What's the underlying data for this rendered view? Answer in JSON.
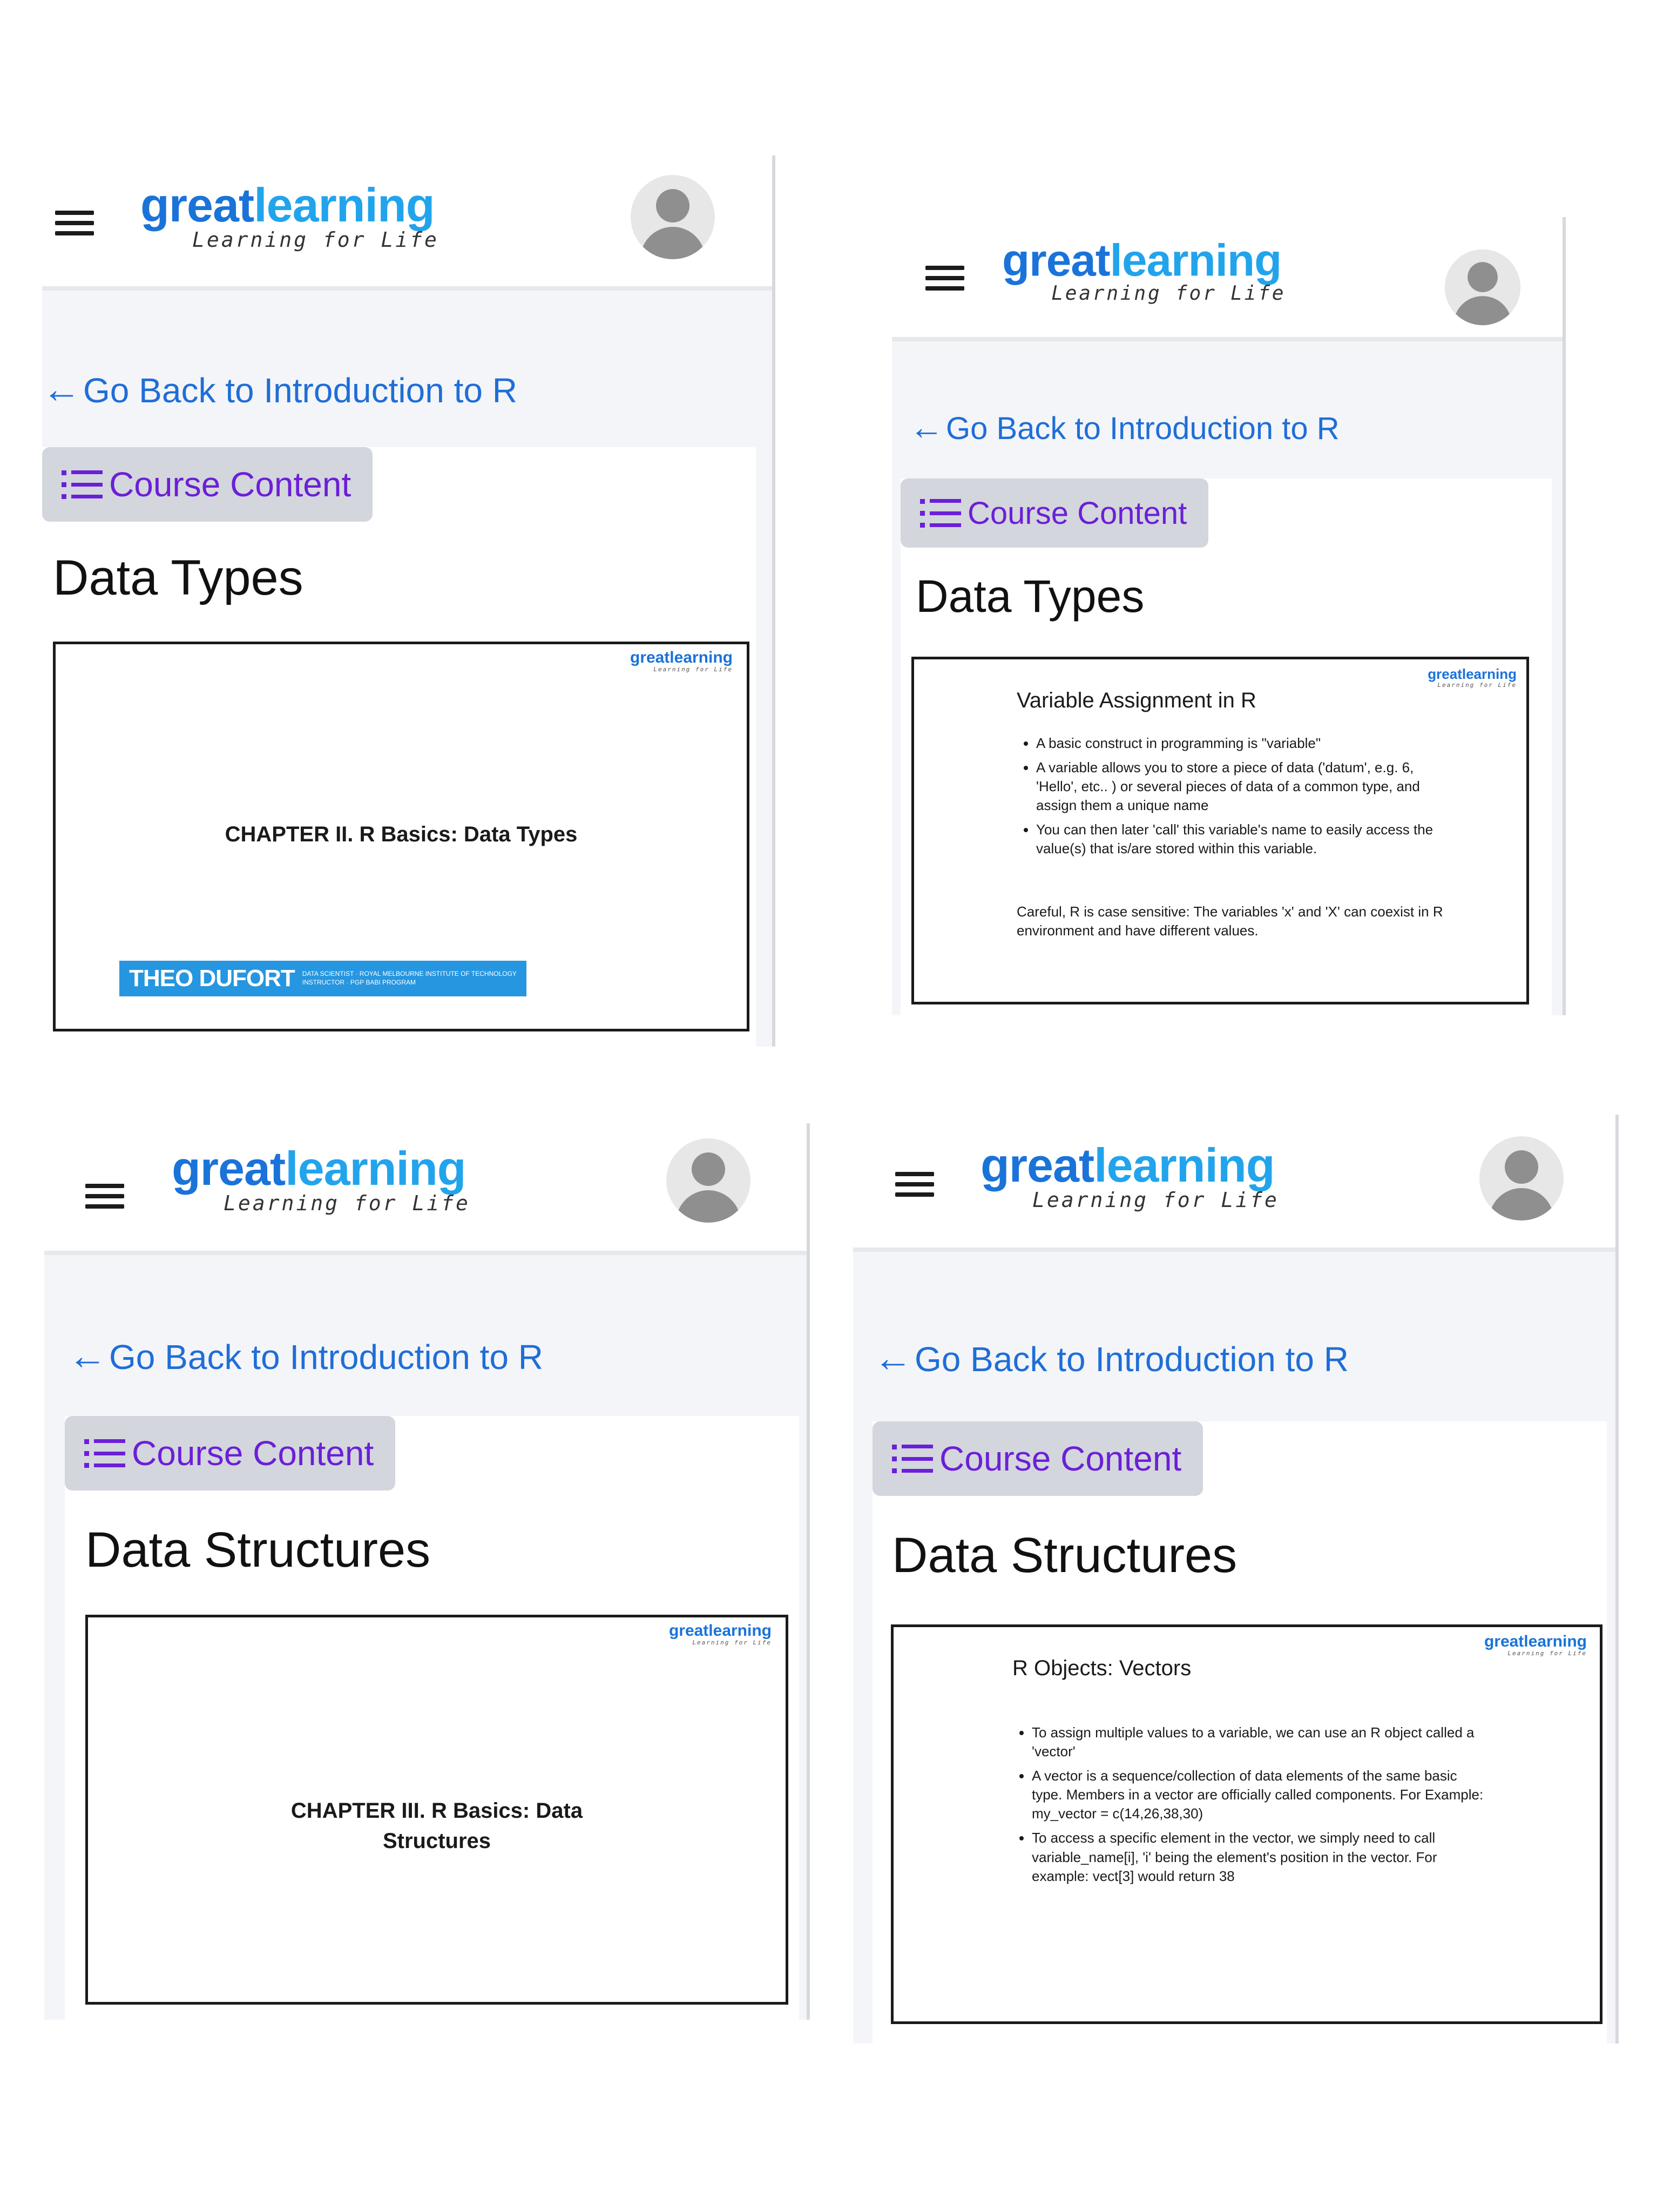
{
  "screens": [
    {
      "logo": {
        "word_a": "great",
        "word_b": "learning",
        "tagline": "Learning for Life"
      },
      "back_link": "Go Back to Introduction to R",
      "course_button": "Course Content",
      "section_title": "Data Types",
      "slide": {
        "logo": "greatlearning",
        "logo_tag": "Learning for Life",
        "chapter": "CHAPTER II.  R Basics: Data Types",
        "instructor_name": "THEO DUFORT",
        "instructor_role_1": "DATA SCIENTIST · ROYAL MELBOURNE INSTITUTE OF TECHNOLOGY",
        "instructor_role_2": "INSTRUCTOR · PGP BABI PROGRAM"
      }
    },
    {
      "logo": {
        "word_a": "great",
        "word_b": "learning",
        "tagline": "Learning for Life"
      },
      "back_link": "Go Back to Introduction to R",
      "course_button": "Course Content",
      "section_title": "Data Types",
      "slide": {
        "logo": "greatlearning",
        "logo_tag": "Learning for Life",
        "heading": "Variable Assignment in R",
        "bullets": [
          "A basic construct in programming is \"variable\"",
          "A variable allows you to store a piece of data ('datum', e.g. 6, 'Hello', etc.. ) or several pieces of data of a common type, and assign them a unique name",
          "You can then later 'call' this variable's name to easily access the value(s) that is/are stored within this variable."
        ],
        "note": "Careful, R is case sensitive: The variables 'x' and 'X' can coexist in R environment and have different values."
      }
    },
    {
      "logo": {
        "word_a": "great",
        "word_b": "learning",
        "tagline": "Learning for Life"
      },
      "back_link": "Go Back to Introduction to R",
      "course_button": "Course Content",
      "section_title": "Data Structures",
      "slide": {
        "logo": "greatlearning",
        "logo_tag": "Learning for Life",
        "chapter_line_1": "CHAPTER III.  R Basics: Data",
        "chapter_line_2": "Structures"
      }
    },
    {
      "logo": {
        "word_a": "great",
        "word_b": "learning",
        "tagline": "Learning for Life"
      },
      "back_link": "Go Back to Introduction to R",
      "course_button": "Course Content",
      "section_title": "Data Structures",
      "slide": {
        "logo": "greatlearning",
        "logo_tag": "Learning for Life",
        "heading": "R Objects: Vectors",
        "bullets": [
          "To assign multiple values to a variable, we can use an R object called a 'vector'",
          "A vector is a sequence/collection of data elements of the same basic type. Members in a vector are officially called components.  For Example: my_vector = c(14,26,38,30)",
          "To access a specific element in the vector, we simply need to call variable_name[i], 'i' being the element's position in the vector. For example: vect[3] would return 38"
        ]
      }
    }
  ],
  "colors": {
    "brand_blue": "#1a73d9",
    "brand_light_blue": "#22a4ec",
    "link_blue": "#1f6ed8",
    "course_purple": "#6b1fd8",
    "course_button_bg": "#d3d6dc",
    "instructor_bar": "#2696e0"
  },
  "icons": [
    "hamburger-menu-icon",
    "user-avatar-icon",
    "back-arrow-icon",
    "list-icon"
  ]
}
